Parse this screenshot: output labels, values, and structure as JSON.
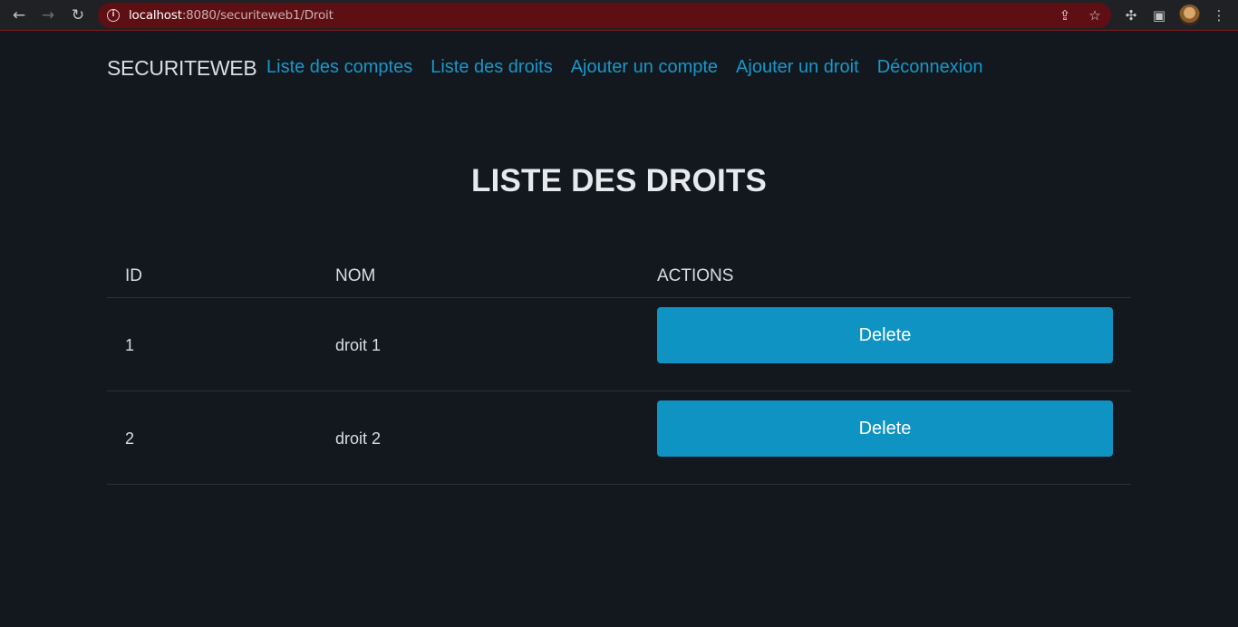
{
  "browser": {
    "url_host": "localhost",
    "url_rest": ":8080/securiteweb1/Droit"
  },
  "navbar": {
    "brand": "SECURITEWEB",
    "links": [
      "Liste des comptes",
      "Liste des droits",
      "Ajouter un compte",
      "Ajouter un droit",
      "Déconnexion"
    ]
  },
  "page": {
    "title": "LISTE DES DROITS"
  },
  "table": {
    "headers": [
      "ID",
      "NOM",
      "ACTIONS"
    ],
    "rows": [
      {
        "id": "1",
        "nom": "droit 1",
        "action": "Delete"
      },
      {
        "id": "2",
        "nom": "droit 2",
        "action": "Delete"
      }
    ]
  },
  "colors": {
    "background": "#13181f",
    "link": "#1897c9",
    "button": "#0f93c3",
    "omnibox": "#5e0f14"
  }
}
